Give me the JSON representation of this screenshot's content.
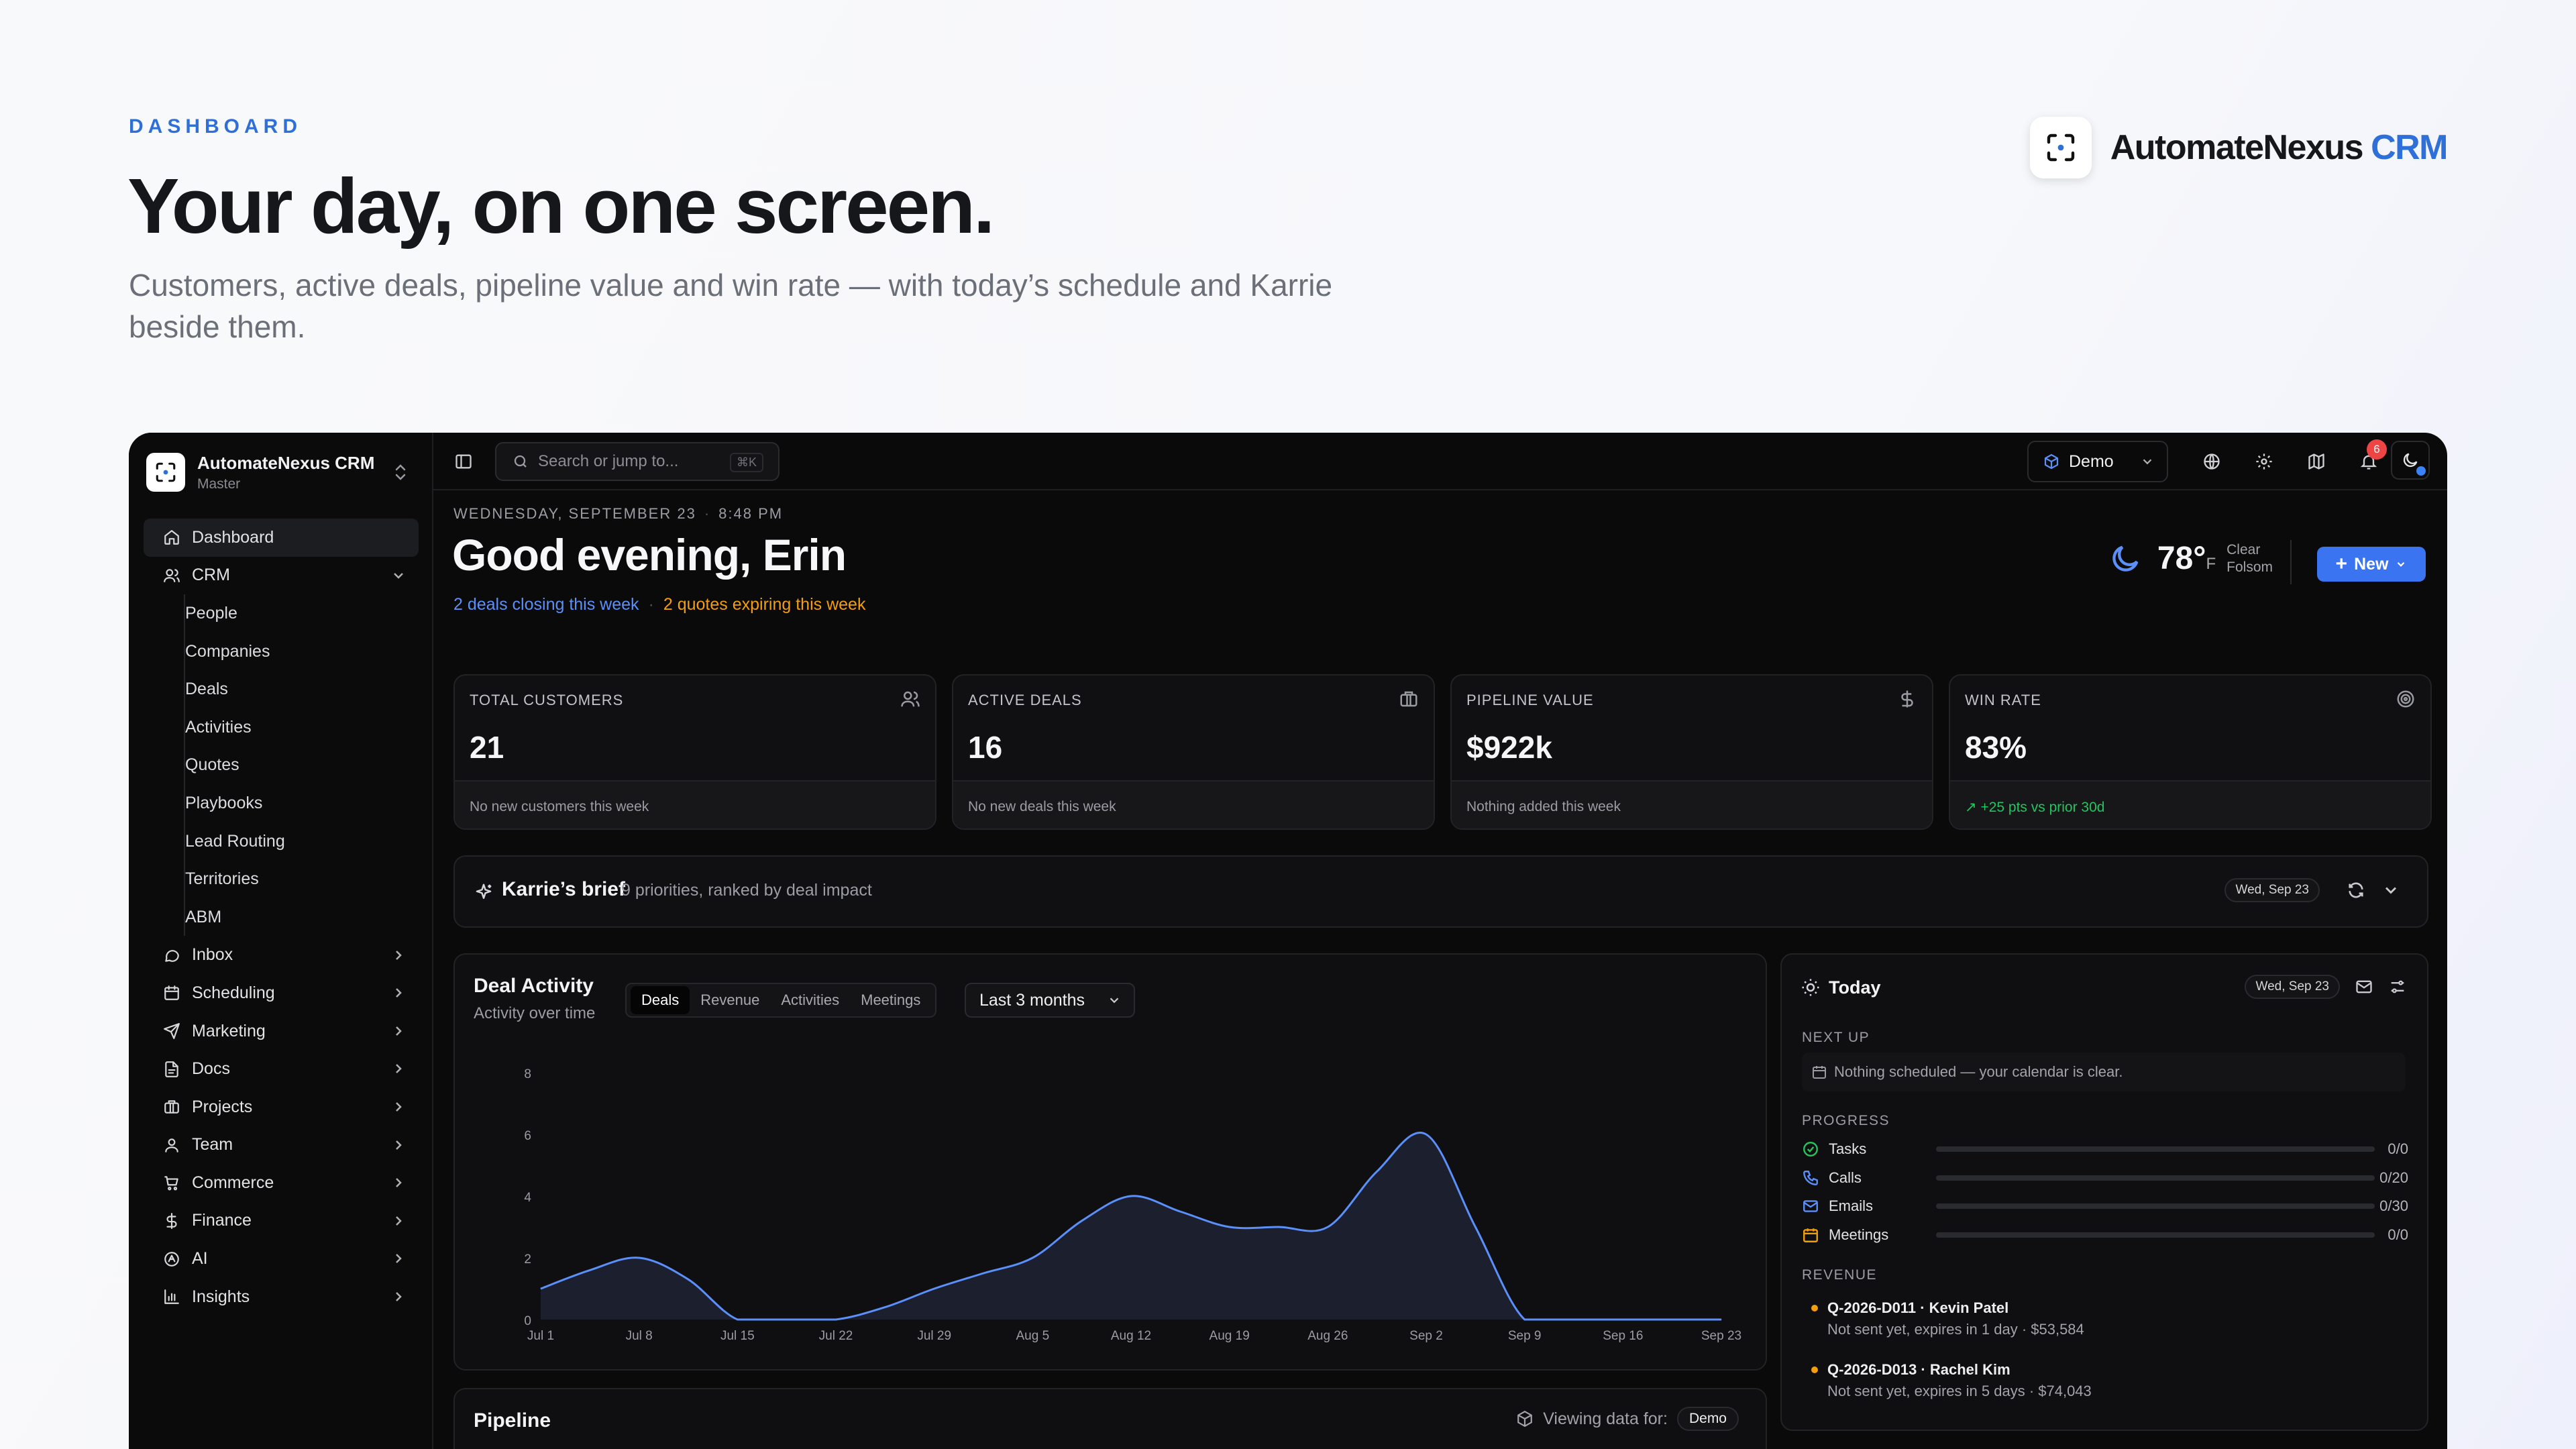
{
  "hero": {
    "eyebrow": "DASHBOARD",
    "title": "Your day, on one screen.",
    "subtitle": "Customers, active deals, pipeline value and win rate — with today’s schedule and Karrie beside them.",
    "brand_main": "AutomateNexus",
    "brand_accent": "CRM"
  },
  "workspace": {
    "name": "AutomateNexus CRM",
    "sub": "Master"
  },
  "sidebar": {
    "dashboard": "Dashboard",
    "crm": "CRM",
    "crm_items": [
      "People",
      "Companies",
      "Deals",
      "Activities",
      "Quotes",
      "Playbooks",
      "Lead Routing",
      "Territories",
      "ABM"
    ],
    "groups": [
      {
        "label": "Inbox",
        "icon": "chat-icon"
      },
      {
        "label": "Scheduling",
        "icon": "calendar-icon"
      },
      {
        "label": "Marketing",
        "icon": "send-icon"
      },
      {
        "label": "Docs",
        "icon": "document-icon"
      },
      {
        "label": "Projects",
        "icon": "briefcase-icon"
      },
      {
        "label": "Team",
        "icon": "user-icon"
      },
      {
        "label": "Commerce",
        "icon": "cart-icon"
      },
      {
        "label": "Finance",
        "icon": "dollar-icon"
      },
      {
        "label": "AI",
        "icon": "ai-icon"
      },
      {
        "label": "Insights",
        "icon": "bar-chart-icon"
      }
    ]
  },
  "topbar": {
    "search_placeholder": "Search or jump to...",
    "search_shortcut": "⌘K",
    "workspace_selector": "Demo",
    "notifications_count": "6"
  },
  "header": {
    "date": "WEDNESDAY, SEPTEMBER 23",
    "time": "8:48 PM",
    "greeting": "Good evening, Erin",
    "alert_deals": "2 deals closing this week",
    "alert_quotes": "2 quotes expiring this week",
    "weather_temp": "78°",
    "weather_unit": "F",
    "weather_cond": "Clear",
    "weather_city": "Folsom",
    "new_button": "New"
  },
  "kpis": [
    {
      "label": "TOTAL CUSTOMERS",
      "value": "21",
      "foot": "No new customers this week",
      "icon": "users-icon"
    },
    {
      "label": "ACTIVE DEALS",
      "value": "16",
      "foot": "No new deals this week",
      "icon": "briefcase-icon"
    },
    {
      "label": "PIPELINE VALUE",
      "value": "$922k",
      "foot": "Nothing added this week",
      "icon": "dollar-icon"
    },
    {
      "label": "WIN RATE",
      "value": "83%",
      "foot": "+25 pts vs prior 30d",
      "icon": "target-icon"
    }
  ],
  "brief": {
    "title": "Karrie’s brief",
    "sub": "9 priorities, ranked by deal impact",
    "date": "Wed, Sep 23"
  },
  "activity": {
    "title": "Deal Activity",
    "subtitle": "Activity over time",
    "tabs": [
      "Deals",
      "Revenue",
      "Activities",
      "Meetings"
    ],
    "range": "Last 3 months"
  },
  "chart_data": {
    "type": "area",
    "x": [
      "Jul 1",
      "Jul 4",
      "Jul 8",
      "Jul 11",
      "Jul 15",
      "Jul 18",
      "Jul 22",
      "Jul 25",
      "Jul 29",
      "Aug 1",
      "Aug 5",
      "Aug 8",
      "Aug 12",
      "Aug 15",
      "Aug 19",
      "Aug 22",
      "Aug 26",
      "Aug 29",
      "Sep 2",
      "Sep 5",
      "Sep 9",
      "Sep 12",
      "Sep 16",
      "Sep 19",
      "Sep 23"
    ],
    "values": [
      1,
      1.6,
      2,
      1.3,
      0,
      0,
      0,
      0.4,
      1,
      1.5,
      2,
      3.2,
      4,
      3.5,
      3,
      3,
      3,
      4.8,
      6,
      3,
      0,
      0,
      0,
      0,
      0
    ],
    "xticks": [
      "Jul 1",
      "Jul 8",
      "Jul 15",
      "Jul 22",
      "Jul 29",
      "Aug 5",
      "Aug 12",
      "Aug 19",
      "Aug 26",
      "Sep 2",
      "Sep 9",
      "Sep 16",
      "Sep 23"
    ],
    "yticks": [
      "0",
      "2",
      "4",
      "6",
      "8"
    ],
    "ylim": [
      0,
      8
    ],
    "color": "#5b8ff9"
  },
  "today": {
    "title": "Today",
    "date": "Wed, Sep 23",
    "next_up_label": "NEXT UP",
    "next_up_empty": "Nothing scheduled — your calendar is clear.",
    "progress_label": "PROGRESS",
    "progress": [
      {
        "name": "Tasks",
        "value": "0/0",
        "icon": "check-circle-icon",
        "color": "#22c55e",
        "fill": 0
      },
      {
        "name": "Calls",
        "value": "0/20",
        "icon": "phone-icon",
        "color": "#5b8ff9",
        "fill": 0
      },
      {
        "name": "Emails",
        "value": "0/30",
        "icon": "mail-icon",
        "color": "#5b8ff9",
        "fill": 0
      },
      {
        "name": "Meetings",
        "value": "0/0",
        "icon": "calendar-icon",
        "color": "#f59e0b",
        "fill": 0
      }
    ],
    "revenue_label": "REVENUE",
    "revenue": [
      {
        "title": "Q-2026-D011 · Kevin Patel",
        "sub": "Not sent yet, expires in 1 day · $53,584"
      },
      {
        "title": "Q-2026-D013 · Rachel Kim",
        "sub": "Not sent yet, expires in 5 days · $74,043"
      }
    ]
  },
  "pipeline": {
    "title": "Pipeline",
    "viewing_label": "Viewing data for:",
    "viewing_value": "Demo"
  }
}
